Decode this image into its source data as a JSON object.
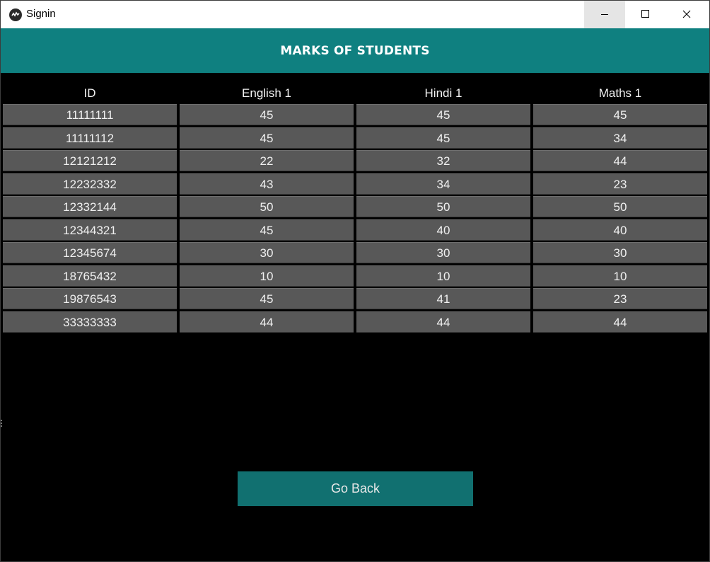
{
  "window": {
    "title": "Signin",
    "minimize_icon": "minimize-icon",
    "maximize_icon": "maximize-icon",
    "close_icon": "close-icon"
  },
  "header": {
    "title": "MARKS OF STUDENTS",
    "color": "#0f8080"
  },
  "table": {
    "columns": [
      "ID",
      "English 1",
      "Hindi 1",
      "Maths 1"
    ],
    "rows": [
      [
        "11111111",
        "45",
        "45",
        "45"
      ],
      [
        "11111112",
        "45",
        "45",
        "34"
      ],
      [
        "12121212",
        "22",
        "32",
        "44"
      ],
      [
        "12232332",
        "43",
        "34",
        "23"
      ],
      [
        "12332144",
        "50",
        "50",
        "50"
      ],
      [
        "12344321",
        "45",
        "40",
        "40"
      ],
      [
        "12345674",
        "30",
        "30",
        "30"
      ],
      [
        "18765432",
        "10",
        "10",
        "10"
      ],
      [
        "19876543",
        "45",
        "41",
        "23"
      ],
      [
        "33333333",
        "44",
        "44",
        "44"
      ]
    ],
    "cell_color": "#585858"
  },
  "actions": {
    "go_back_label": "Go Back",
    "button_color": "#117070"
  }
}
